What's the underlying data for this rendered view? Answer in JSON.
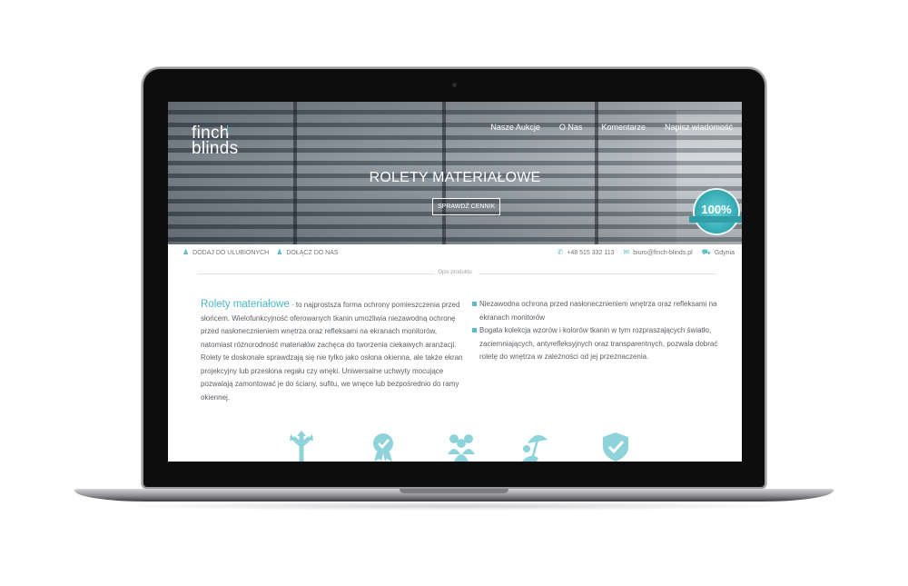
{
  "site": {
    "logo_line1": "finch",
    "logo_line2": "blinds",
    "nav": [
      "Nasze Aukcje",
      "O Nas",
      "Komentarze",
      "Napisz wiadomość"
    ]
  },
  "hero": {
    "title": "ROLETY MATERIAŁOWE",
    "button_label": "SPRAWDŹ CENNIK",
    "badge_text": "100%"
  },
  "infobar": {
    "favorites_label": "DODAJ DO ULUBIONYCH",
    "join_label": "DOŁĄCZ DO NAS",
    "phone": "+48 515 332 113",
    "email": "biuro@finch-blinds.pl",
    "city": "Gdynia"
  },
  "section": {
    "label": "Opis produktu"
  },
  "description": {
    "lead": "Rolety materiałowe",
    "lead_dash": " - ",
    "body": "to najprostsza forma ochrony pomieszczenia przed słońcem. Wielofunkcyjność oferowanych tkanin umożliwia niezawodną ochronę przed nasłonecznieniem wnętrza oraz refleksami na ekranach monitorów, natomiast różnorodność materiałów zachęca do tworzenia ciekawych aranżacji. Rolety te doskonale sprawdzają się nie tylko jako osłona okienna, ale także ekran projekcyjny lub przesłona regału czy wnęki. Uniwersalne uchwyty mocujące pozwalają zamontować je do ściany, sufitu, we wnęce lub bezpośrednio do ramy okiennej.",
    "bullets": [
      "Niezawodna ochrona przed nasłonecznieniem wnętrza oraz refleksami na ekranach monitorów",
      "Bogata kolekcja wzorów i kolorów tkanin w tym rozpraszających światło, zaciemniających, antyrefleksyjnych oraz transparentnych, pozwala dobrać roletę do wnętrza w zależności od jej przeznaczenia."
    ]
  },
  "features": [
    "arrows-icon",
    "certificate-icon",
    "people-icon",
    "beach-umbrella-icon",
    "shield-check-icon"
  ],
  "colors": {
    "accent": "#5bbcc6",
    "text": "#5a5f64",
    "laptop_body": "#0d0d0e"
  }
}
